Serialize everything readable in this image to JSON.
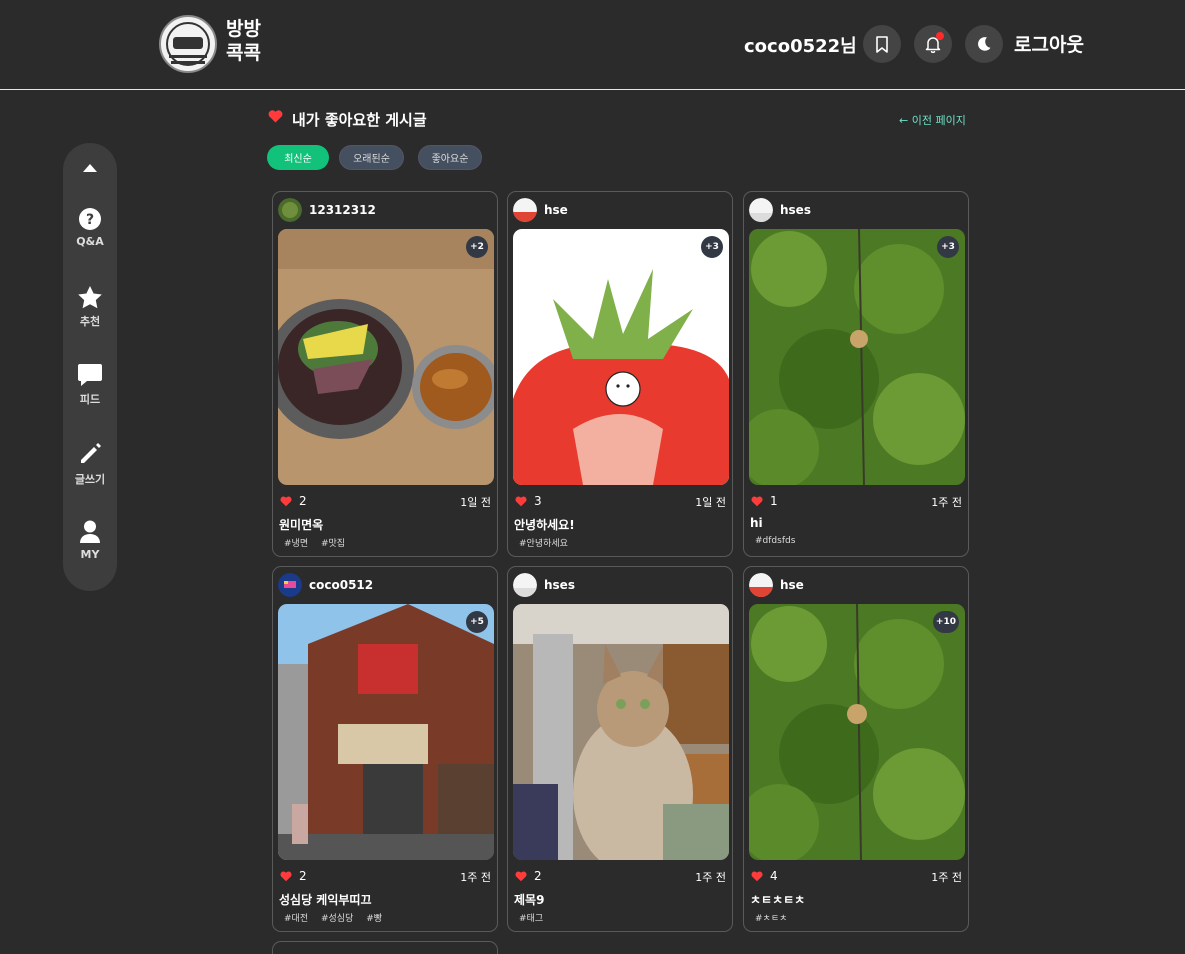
{
  "header": {
    "brand_line1": "방방",
    "brand_line2": "콕콕",
    "username": "coco0522님",
    "logout": "로그아웃"
  },
  "sidebar": {
    "items": [
      {
        "label": "Q&A"
      },
      {
        "label": "추천"
      },
      {
        "label": "피드"
      },
      {
        "label": "글쓰기"
      },
      {
        "label": "MY"
      }
    ]
  },
  "page": {
    "title": "내가 좋아요한 게시글",
    "back": "← 이전 페이지"
  },
  "sort": [
    "최신순",
    "오래된순",
    "좋아요순"
  ],
  "cards": [
    {
      "author": "12312312",
      "badge": "+2",
      "likes": "2",
      "time": "1일 전",
      "title": "원미면옥",
      "tags": [
        "#냉면",
        "#맛집"
      ]
    },
    {
      "author": "hse",
      "badge": "+3",
      "likes": "3",
      "time": "1일 전",
      "title": "안녕하세요!",
      "tags": [
        "#안녕하세요"
      ]
    },
    {
      "author": "hses",
      "badge": "+3",
      "likes": "1",
      "time": "1주 전",
      "title": "hi",
      "tags": [
        "#dfdsfds"
      ]
    },
    {
      "author": "coco0512",
      "badge": "+5",
      "likes": "2",
      "time": "1주 전",
      "title": "성심당 케익부띠끄",
      "tags": [
        "#대전",
        "#성심당",
        "#빵"
      ]
    },
    {
      "author": "hses",
      "badge": "",
      "likes": "2",
      "time": "1주 전",
      "title": "제목9",
      "tags": [
        "#태그"
      ]
    },
    {
      "author": "hse",
      "badge": "+10",
      "likes": "4",
      "time": "1주 전",
      "title": "ㅊㅌㅊㅌㅊ",
      "tags": [
        "#ㅊㅌㅊ"
      ]
    }
  ],
  "colors": {
    "background": "#2b2b2b",
    "accent": "#12c27a",
    "heart": "#ff3b3b",
    "link": "#6fe0c4"
  }
}
